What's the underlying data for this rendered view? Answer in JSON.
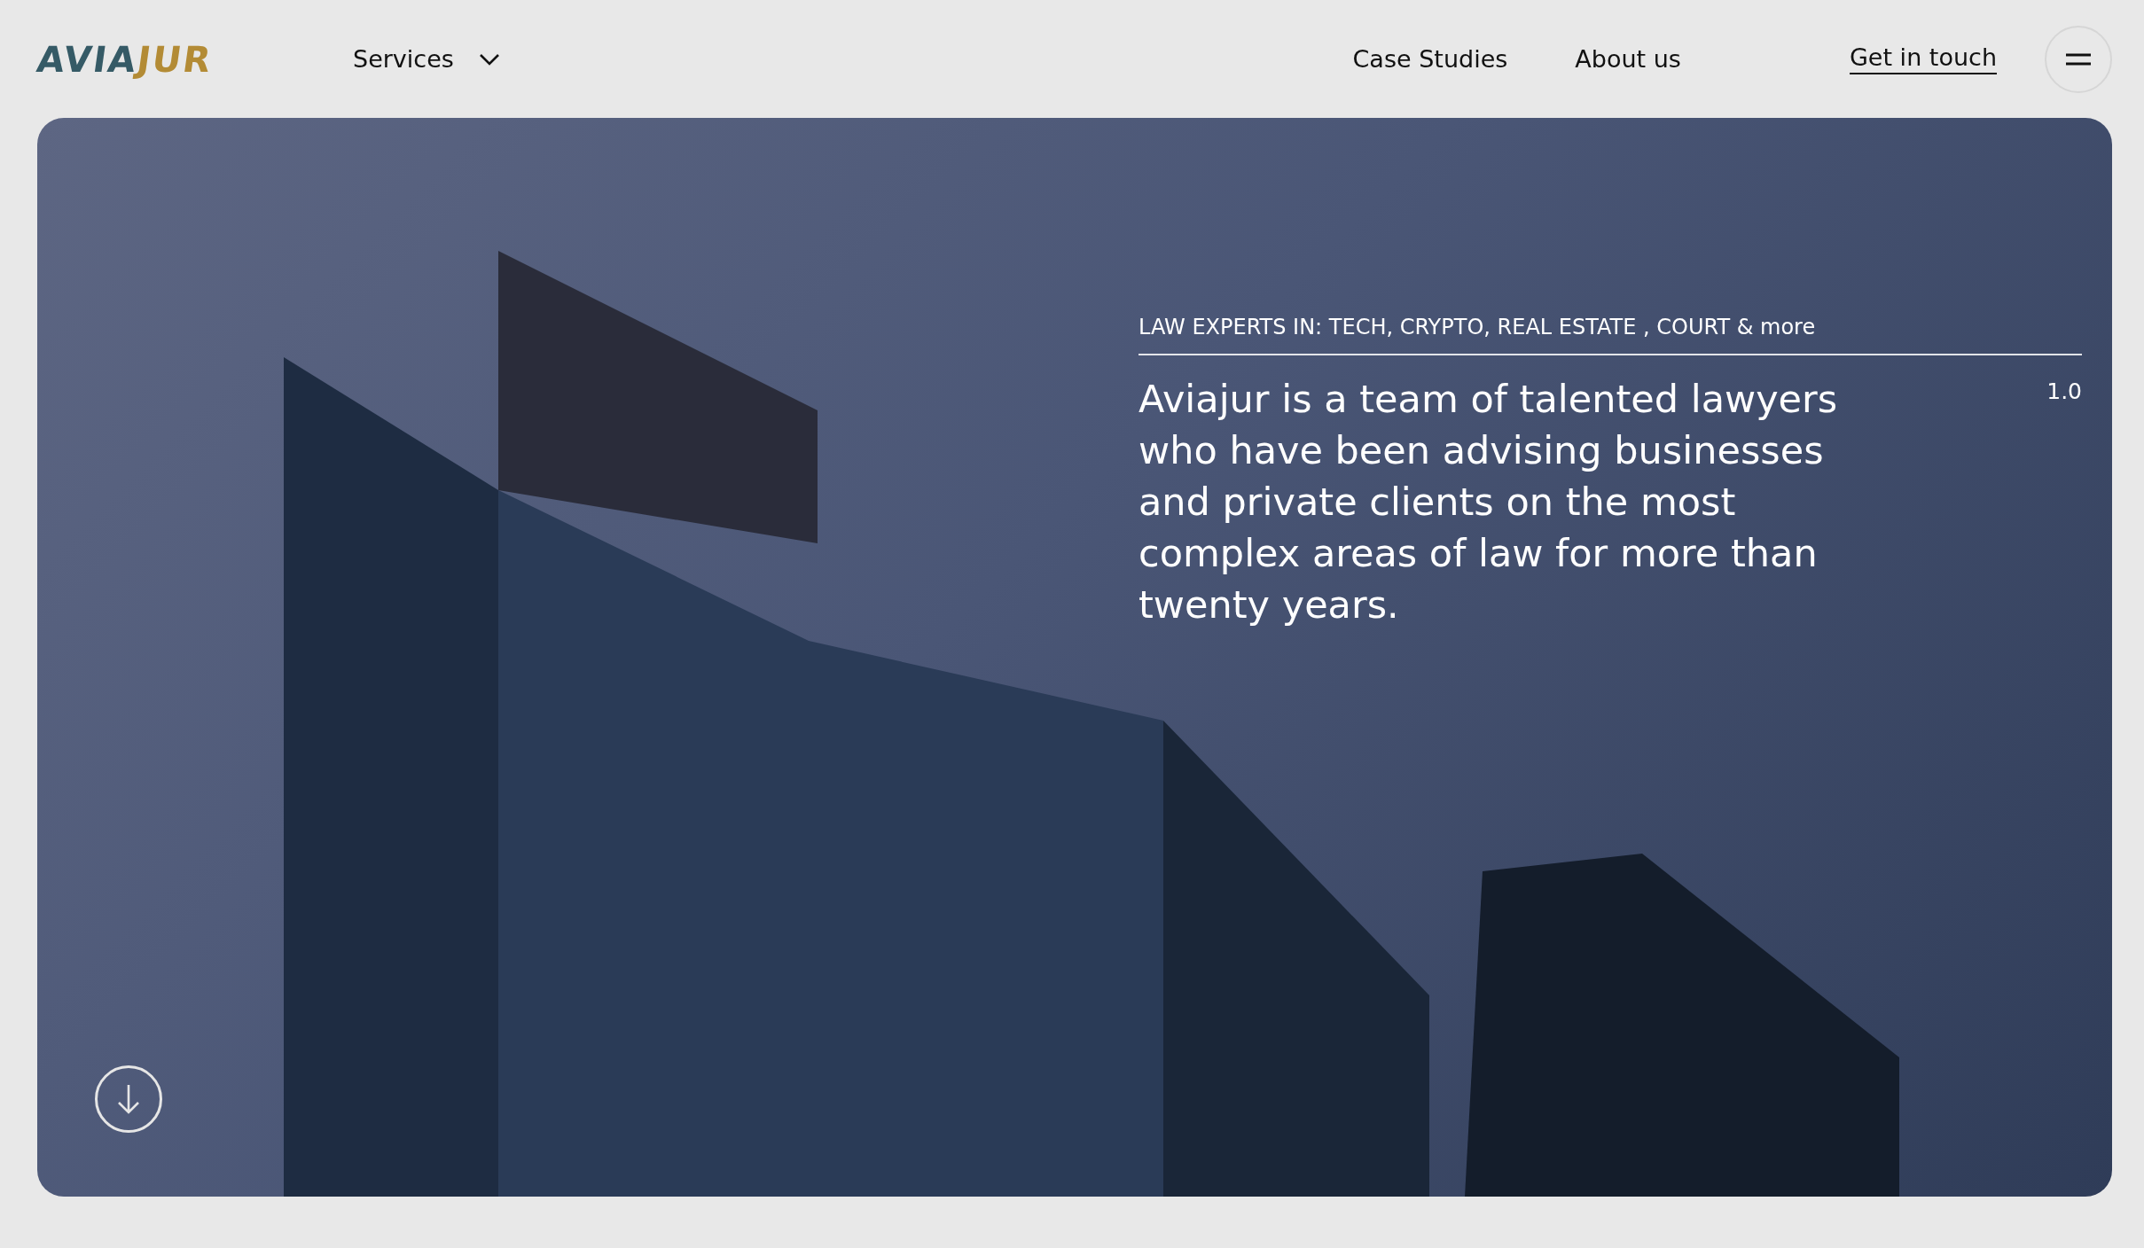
{
  "header": {
    "logo": {
      "part_1": "AVIA",
      "part_2": "JUR"
    },
    "nav": [
      {
        "label": "Services",
        "kind": "dropdown"
      },
      {
        "label": "Case Studies",
        "kind": "link"
      },
      {
        "label": "About us",
        "kind": "link"
      }
    ],
    "cta": "Get in touch"
  },
  "hero": {
    "tagline": "LAW EXPERTS IN: TECH, CRYPTO, REAL ESTATE , COURT & more",
    "text": "Aviajur is a team of talented lawyers who have been advising businesses and private clients on the most complex areas of law for more than twenty years.",
    "index": "1.0"
  }
}
